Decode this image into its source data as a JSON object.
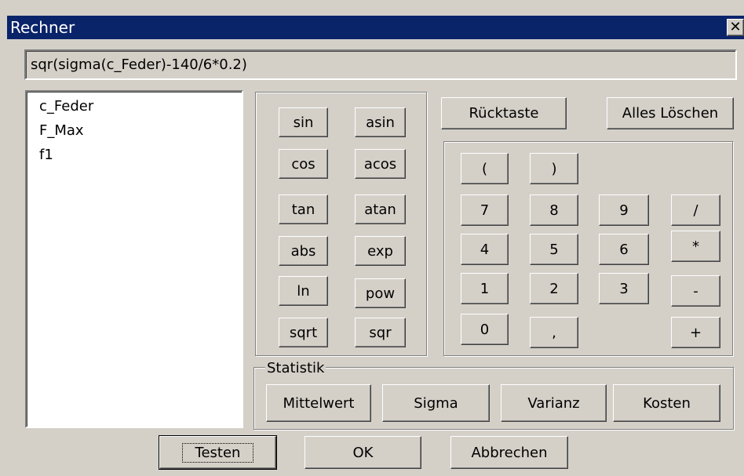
{
  "window": {
    "title": "Rechner"
  },
  "formula": {
    "value": "sqr(sigma(c_Feder)-140/6*0.2)"
  },
  "variables": [
    "c_Feder",
    "F_Max",
    "f1"
  ],
  "functions": {
    "sin": "sin",
    "asin": "asin",
    "cos": "cos",
    "acos": "acos",
    "tan": "tan",
    "atan": "atan",
    "abs": "abs",
    "exp": "exp",
    "ln": "ln",
    "pow": "pow",
    "sqrt": "sqrt",
    "sqr": "sqr"
  },
  "edit": {
    "backspace": "Rücktaste",
    "clear_all": "Alles Löschen"
  },
  "keypad": {
    "lparen": "(",
    "rparen": ")",
    "k7": "7",
    "k8": "8",
    "k9": "9",
    "div": "/",
    "k4": "4",
    "k5": "5",
    "k6": "6",
    "mul": "*",
    "k1": "1",
    "k2": "2",
    "k3": "3",
    "minus": "-",
    "k0": "0",
    "comma": ",",
    "plus": "+"
  },
  "statistik": {
    "legend": "Statistik",
    "mittelwert": "Mittelwert",
    "sigma": "Sigma",
    "varianz": "Varianz",
    "kosten": "Kosten"
  },
  "footer": {
    "testen": "Testen",
    "ok": "OK",
    "abbrechen": "Abbrechen"
  }
}
